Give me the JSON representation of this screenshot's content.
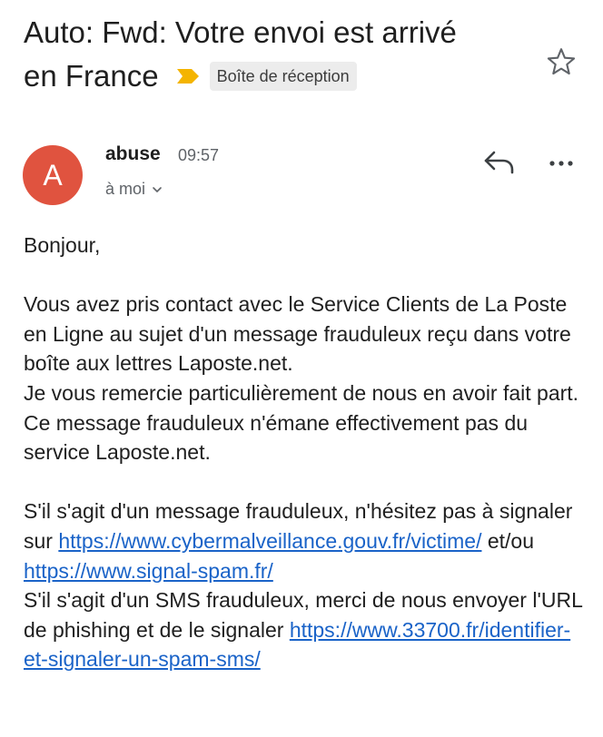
{
  "email": {
    "subject_line1": "Auto: Fwd: Votre envoi est arrivé",
    "subject_line2": "en France",
    "label": "Boîte de réception",
    "sender": "abuse",
    "time": "09:57",
    "recipient": "à moi",
    "avatar_letter": "A",
    "avatar_color": "#e0533f"
  },
  "icons": {
    "star": "star-outline-icon",
    "reply": "reply-icon",
    "more": "more-horizontal-icon",
    "chevron": "chevron-down-icon",
    "important": "important-marker-icon"
  },
  "body": {
    "greeting": "Bonjour,",
    "para1": "Vous avez pris contact avec le Service Clients de La Poste en Ligne au sujet d'un message frauduleux reçu dans votre boîte aux lettres Laposte.net.",
    "para2": "Je vous remercie particulièrement de nous en avoir fait part. Ce message frauduleux n'émane effectivement pas du service Laposte.net.",
    "para3_text": "S'il s'agit d'un message frauduleux, n'hésitez pas à signaler sur",
    "link1": "https://www.cybermalveillance.gouv.fr/victime/",
    "link_sep": "et/ou",
    "link2": "https://www.signal-spam.fr/",
    "para4_text": "S'il s'agit d'un SMS frauduleux, merci de nous envoyer l'URL de phishing et de le signaler",
    "link3": "https://www.33700.fr/identifier-et-signaler-un-spam-sms/"
  },
  "colors": {
    "link": "#1a63c8",
    "important_marker": "#f4b400"
  }
}
